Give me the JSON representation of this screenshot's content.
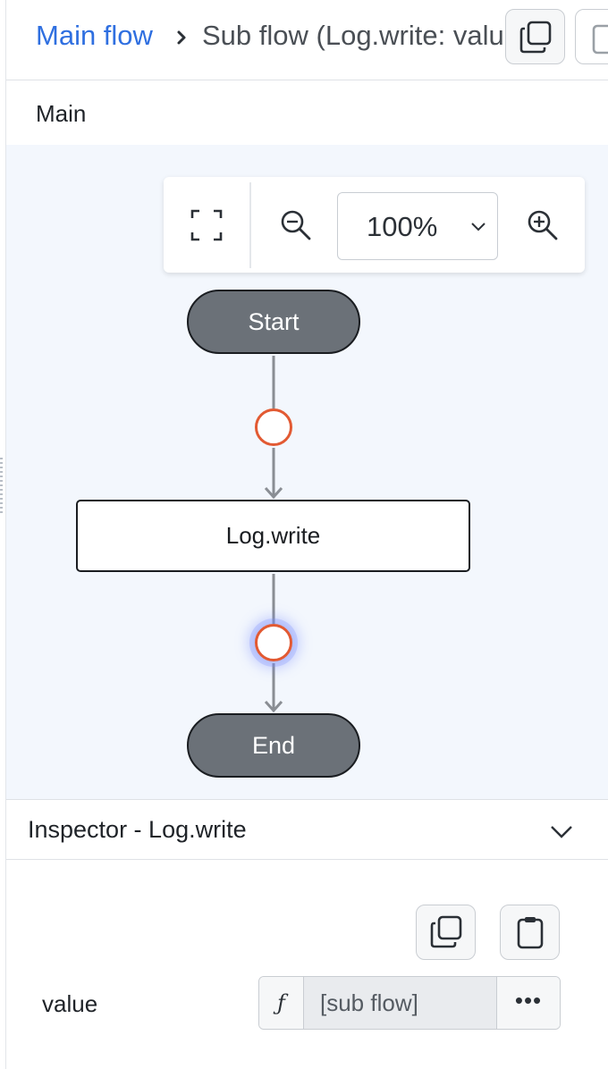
{
  "header": {
    "breadcrumb_root": "Main flow",
    "breadcrumb_current": "Sub flow (Log.write: value)"
  },
  "section": {
    "title": "Main"
  },
  "toolbar": {
    "zoom_value": "100%",
    "zoom_options": [
      "100%"
    ]
  },
  "flow": {
    "start_label": "Start",
    "action_label": "Log.write",
    "end_label": "End"
  },
  "inspector": {
    "title": "Inspector - Log.write",
    "property_label": "value",
    "fn_glyph": "ƒ",
    "property_value": "[sub flow]",
    "more_label": "•••"
  },
  "colors": {
    "link": "#2f6fe0",
    "canvas_bg": "#f3f7fd",
    "terminal_node": "#6b7178",
    "port_ring": "#e25a33",
    "port_glow": "#6e82ff"
  },
  "icons": [
    "chevron-right-icon",
    "copy-icon",
    "paste-icon",
    "fit-screen-icon",
    "zoom-out-icon",
    "chevron-down-icon",
    "zoom-in-icon",
    "collapse-chevron-icon",
    "function-icon",
    "more-icon"
  ]
}
